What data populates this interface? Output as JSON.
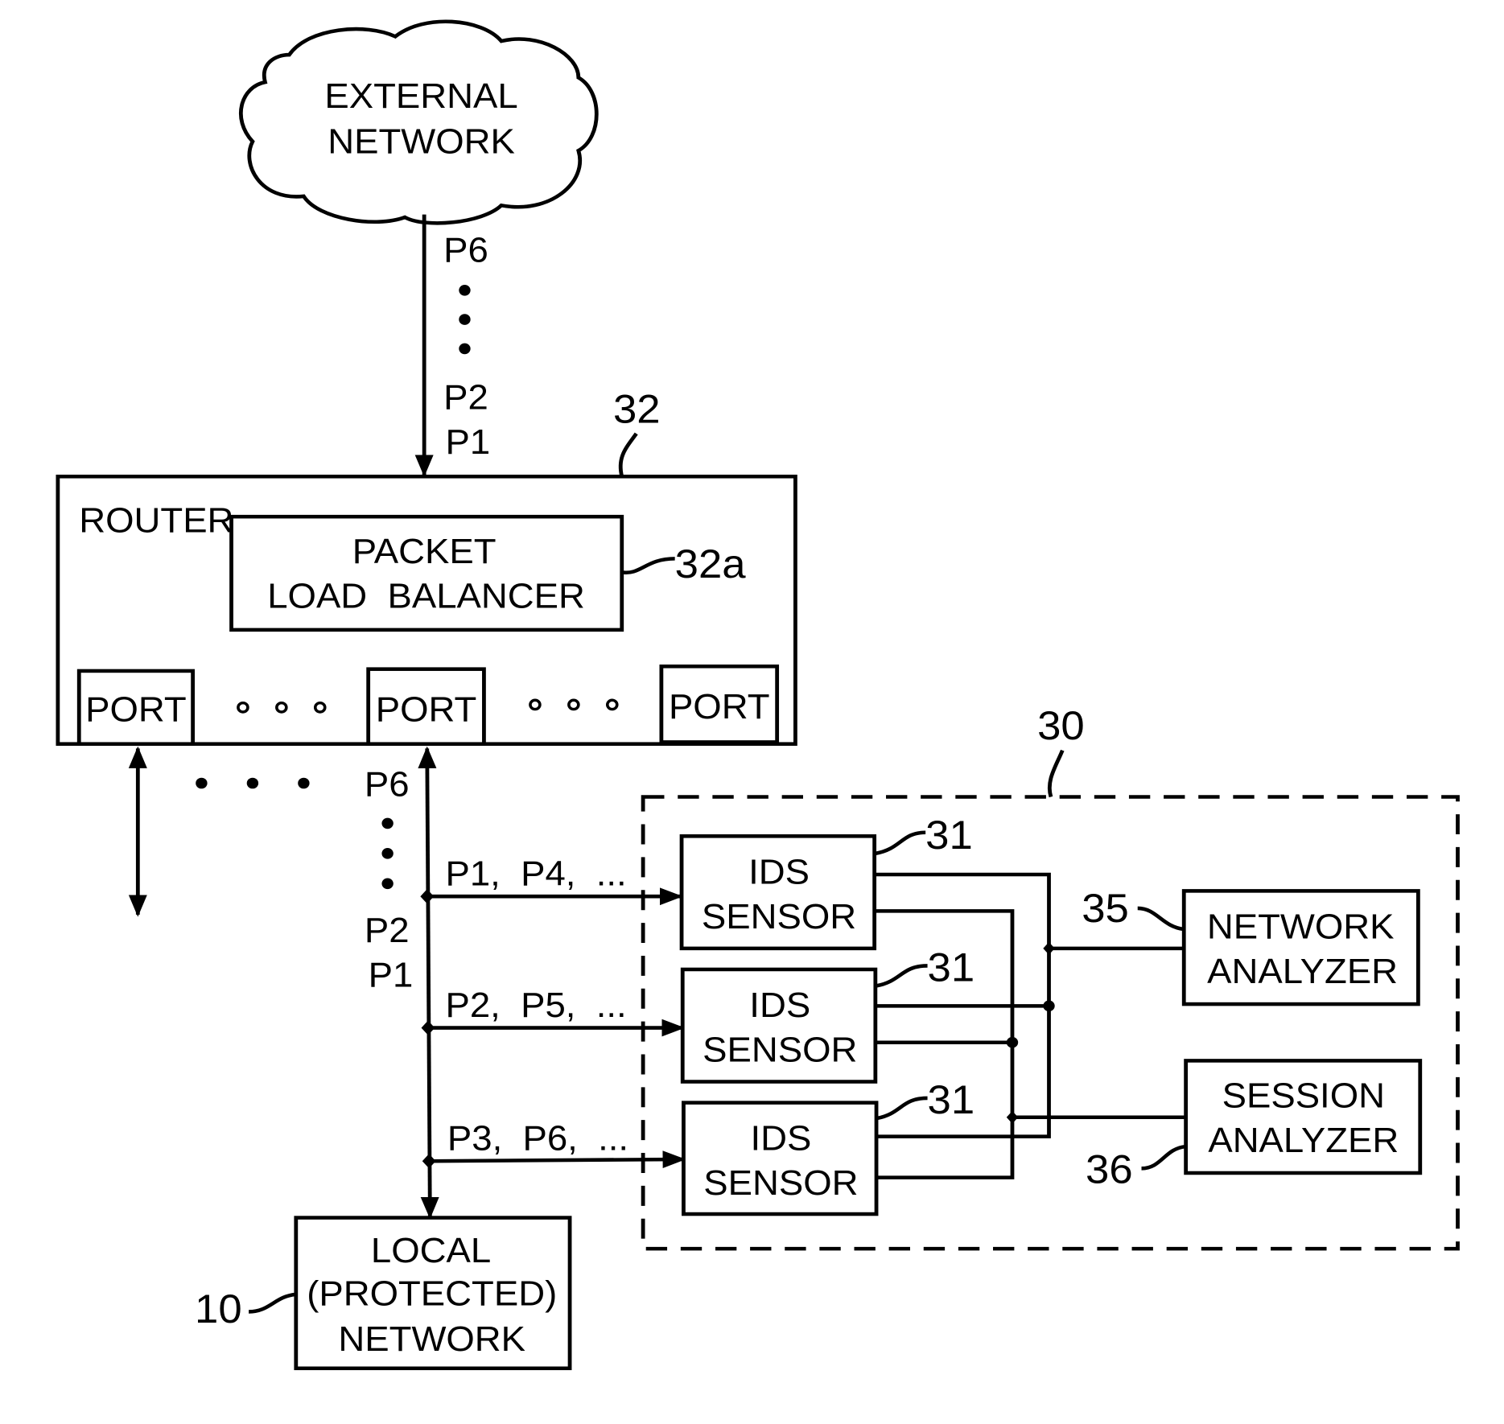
{
  "figure": {
    "external_network": {
      "lines": [
        "EXTERNAL",
        "NETWORK"
      ]
    },
    "inbound_packets": {
      "top": "P6",
      "bottom": [
        "P2",
        "P1"
      ]
    },
    "router": {
      "ref": "32",
      "label": "ROUTER",
      "load_balancer": {
        "ref": "32a",
        "lines": [
          "PACKET",
          "LOAD  BALANCER"
        ]
      },
      "ports": [
        "PORT",
        "PORT",
        "PORT"
      ]
    },
    "outbound_packets": {
      "top": "P6",
      "bottom": [
        "P2",
        "P1"
      ]
    },
    "ids_system": {
      "ref": "30",
      "sensors": [
        {
          "ref": "31",
          "lines": [
            "IDS",
            "SENSOR"
          ],
          "packets": "P1,  P4,  ..."
        },
        {
          "ref": "31",
          "lines": [
            "IDS",
            "SENSOR"
          ],
          "packets": "P2,  P5,  ..."
        },
        {
          "ref": "31",
          "lines": [
            "IDS",
            "SENSOR"
          ],
          "packets": "P3,  P6,  ..."
        }
      ],
      "network_analyzer": {
        "ref": "35",
        "lines": [
          "NETWORK",
          "ANALYZER"
        ]
      },
      "session_analyzer": {
        "ref": "36",
        "lines": [
          "SESSION",
          "ANALYZER"
        ]
      }
    },
    "local_network": {
      "ref": "10",
      "lines": [
        "LOCAL",
        "(PROTECTED)",
        "NETWORK"
      ]
    }
  }
}
